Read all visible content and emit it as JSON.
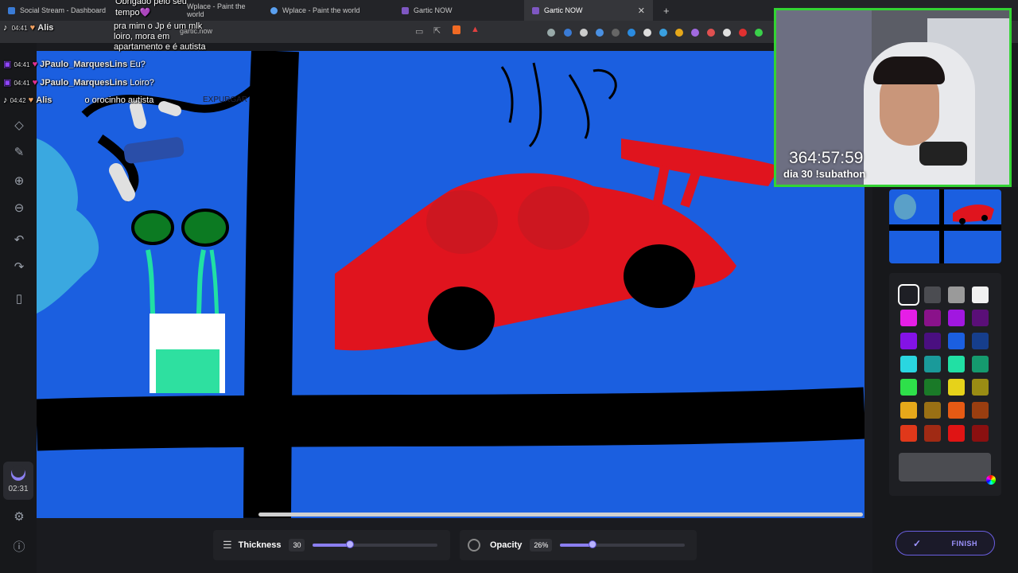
{
  "browser": {
    "tabs": [
      {
        "label": "Social Stream - Dashboard"
      },
      {
        "label": "Wplace - Paint the world"
      },
      {
        "label": "Wplace - Paint the world"
      },
      {
        "label": "Gartic NOW"
      },
      {
        "label": "Gartic NOW"
      }
    ],
    "new_tab": "+",
    "address": "gartic.now"
  },
  "chat": [
    {
      "time": "",
      "user": "",
      "message": "Obrigado pelo seu"
    },
    {
      "time": "",
      "user": "",
      "message": "tempo💜"
    },
    {
      "time": "04:41",
      "user": "Alis",
      "message": "pra mim o Jp é um mlk"
    },
    {
      "time": "",
      "user": "",
      "message": "loiro, mora em"
    },
    {
      "time": "",
      "user": "",
      "message": "apartamento e é autista"
    },
    {
      "time": "04:41",
      "user": "JPaulo_MarquesLins",
      "message": "Eu?"
    },
    {
      "time": "04:41",
      "user": "JPaulo_MarquesLins",
      "message": "Loiro?"
    },
    {
      "time": "04:42",
      "user": "Alis",
      "message": "o orocinho autista"
    }
  ],
  "canvas_text": {
    "scribble_top": "JJP",
    "scribble_left": "EXPURGAR"
  },
  "stream": {
    "timer": "364:57:59",
    "subathon": "dia 30 !subathon"
  },
  "left_timer": "02:31",
  "controls": {
    "thickness": {
      "label": "Thickness",
      "value": "30",
      "level": 0.3
    },
    "opacity": {
      "label": "Opacity",
      "value": "26%",
      "level": 0.26
    }
  },
  "finish_label": "FINISH",
  "palette": {
    "colors": [
      "#1e1f25",
      "#4b4c51",
      "#9a9a9a",
      "#f1f1f1",
      "#e61ee6",
      "#8a128a",
      "#a117e0",
      "#5a0f78",
      "#8412e6",
      "#4a0f80",
      "#1b5fe0",
      "#163e8c",
      "#2ad6e0",
      "#1a9a9a",
      "#21e0a4",
      "#159a6e",
      "#2ee04a",
      "#1a7a28",
      "#e6d21a",
      "#9a8c14",
      "#e6a81a",
      "#9a7014",
      "#e65a14",
      "#9a3e10",
      "#e0381a",
      "#a02a14",
      "#e01414",
      "#8a1010"
    ],
    "selected_index": 0
  },
  "colors": {
    "canvas": "#1b5fe0",
    "accent": "#8b7ff0",
    "cam_border": "#33d433"
  }
}
